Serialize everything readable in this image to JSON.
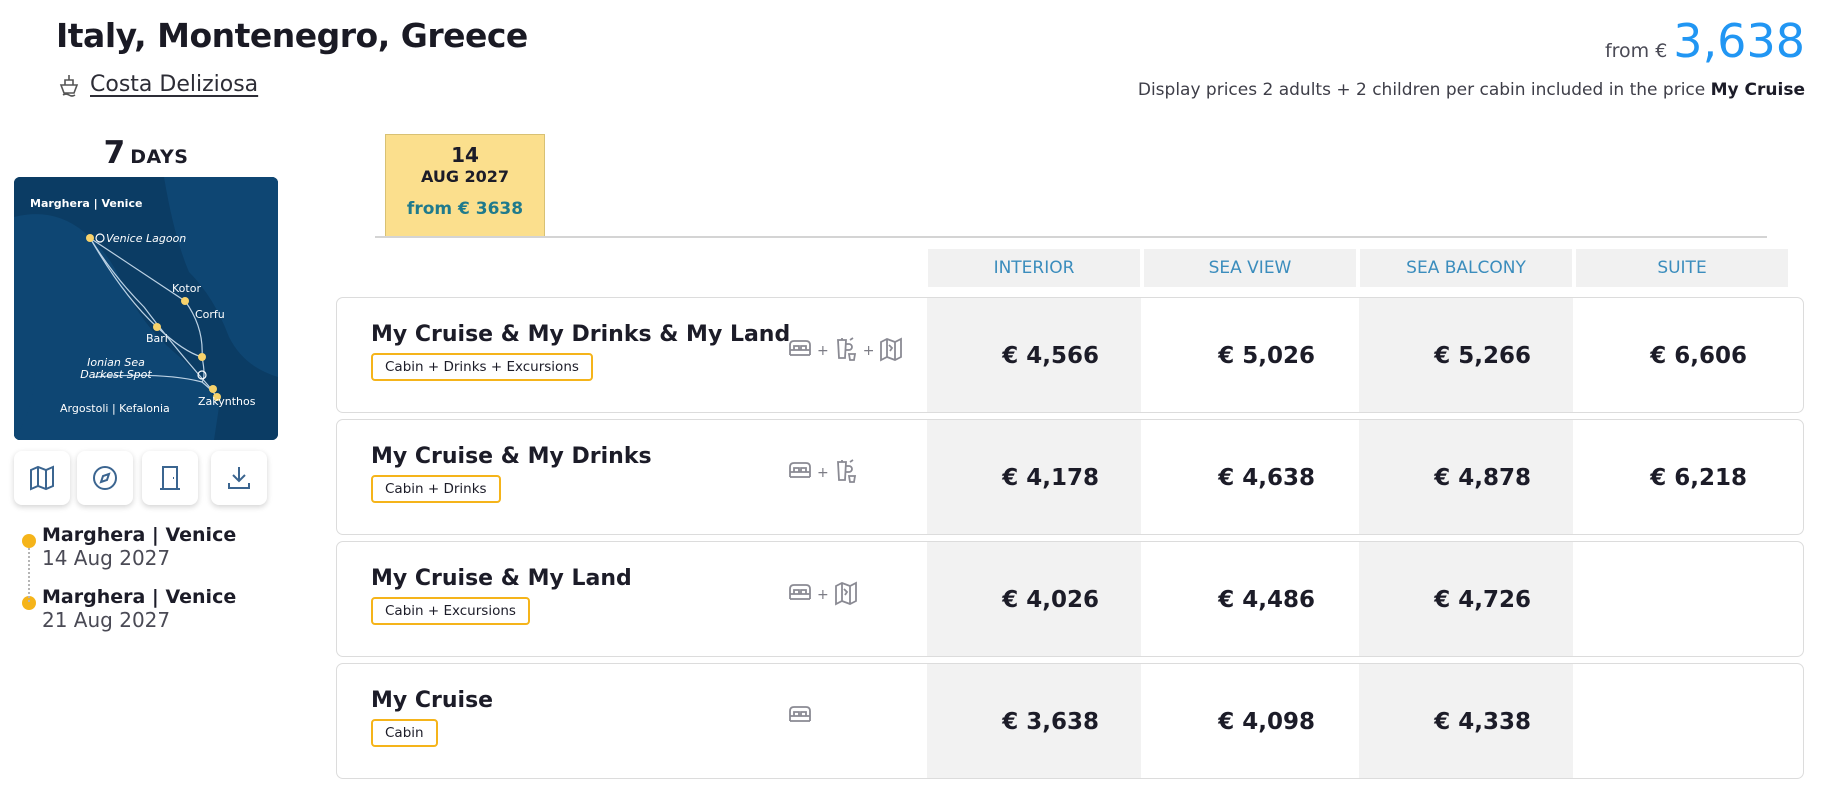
{
  "header": {
    "title": "Italy, Montenegro, Greece",
    "ship": "Costa Deliziosa",
    "from_label": "from €",
    "from_price": "3,638",
    "display_note": "Display prices 2 adults + 2 children per cabin included in the price",
    "display_note_bold": "My Cruise"
  },
  "duration": {
    "number": "7",
    "label": "DAYS"
  },
  "map": {
    "labels": [
      "Marghera | Venice",
      "Venice Lagoon",
      "Kotor",
      "Corfu",
      "Bari",
      "Ionian Sea Darkest Spot",
      "Argostoli | Kefalonia",
      "Zakynthos"
    ]
  },
  "tools": [
    "map-icon",
    "compass-icon",
    "door-icon",
    "download-icon"
  ],
  "itinerary": [
    {
      "port": "Marghera | Venice",
      "date": "14 Aug 2027"
    },
    {
      "port": "Marghera | Venice",
      "date": "21 Aug 2027"
    }
  ],
  "date_tab": {
    "day": "14",
    "month_year": "AUG 2027",
    "price": "from € 3638"
  },
  "cabins": [
    "INTERIOR",
    "SEA VIEW",
    "SEA BALCONY",
    "SUITE"
  ],
  "packages": [
    {
      "name": "My Cruise & My Drinks & My Land",
      "badge": "Cabin + Drinks + Excursions",
      "icons": [
        "cabin-icon",
        "drinks-icon",
        "excursions-icon"
      ],
      "prices": [
        "€ 4,566",
        "€ 5,026",
        "€ 5,266",
        "€ 6,606"
      ]
    },
    {
      "name": "My Cruise & My Drinks",
      "badge": "Cabin + Drinks",
      "icons": [
        "cabin-icon",
        "drinks-icon"
      ],
      "prices": [
        "€ 4,178",
        "€ 4,638",
        "€ 4,878",
        "€ 6,218"
      ]
    },
    {
      "name": "My Cruise & My Land",
      "badge": "Cabin + Excursions",
      "icons": [
        "cabin-icon",
        "excursions-icon"
      ],
      "prices": [
        "€ 4,026",
        "€ 4,486",
        "€ 4,726",
        ""
      ]
    },
    {
      "name": "My Cruise",
      "badge": "Cabin",
      "icons": [
        "cabin-icon"
      ],
      "prices": [
        "€ 3,638",
        "€ 4,098",
        "€ 4,338",
        ""
      ]
    }
  ],
  "colors": {
    "accent_blue": "#2196f3",
    "badge_border": "#f5b41a",
    "tab_bg": "#fbdf8d",
    "map_bg": "#0b3c64",
    "cabin_header_text": "#3b8dbd"
  }
}
